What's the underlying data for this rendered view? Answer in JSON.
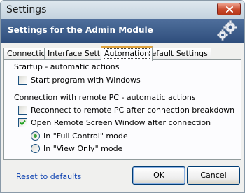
{
  "window": {
    "title": "Settings"
  },
  "banner": {
    "title": "Settings for the Admin Module"
  },
  "tabs": [
    {
      "label": "Connection",
      "active": false
    },
    {
      "label": "Interface Settings",
      "active": false
    },
    {
      "label": "Automation",
      "active": true
    },
    {
      "label": "Default Settings",
      "active": false
    }
  ],
  "startup": {
    "section_label": "Startup - automatic actions",
    "start_with_windows": {
      "label": "Start program with Windows",
      "checked": false
    }
  },
  "connection": {
    "section_label": "Connection with remote PC - automatic actions",
    "reconnect": {
      "label": "Reconnect to remote PC after connection breakdown",
      "checked": false
    },
    "open_window": {
      "label": "Open Remote Screen Window after connection",
      "checked": true
    },
    "mode_full": {
      "label": "In \"Full Control\" mode",
      "selected": true
    },
    "mode_view": {
      "label": "In \"View Only\" mode",
      "selected": false
    }
  },
  "footer": {
    "reset_label": "Reset to defaults",
    "ok_label": "OK",
    "cancel_label": "Cancel"
  },
  "colors": {
    "banner": "#3d5d8c",
    "close_button": "#c94a2d",
    "active_tab_accent": "#e0a33c",
    "link": "#0a3fb0",
    "radio_dot": "#3aa03a"
  },
  "icons": {
    "close": "close-x-icon",
    "gears": "gears-icon",
    "check": "checkmark-icon"
  }
}
